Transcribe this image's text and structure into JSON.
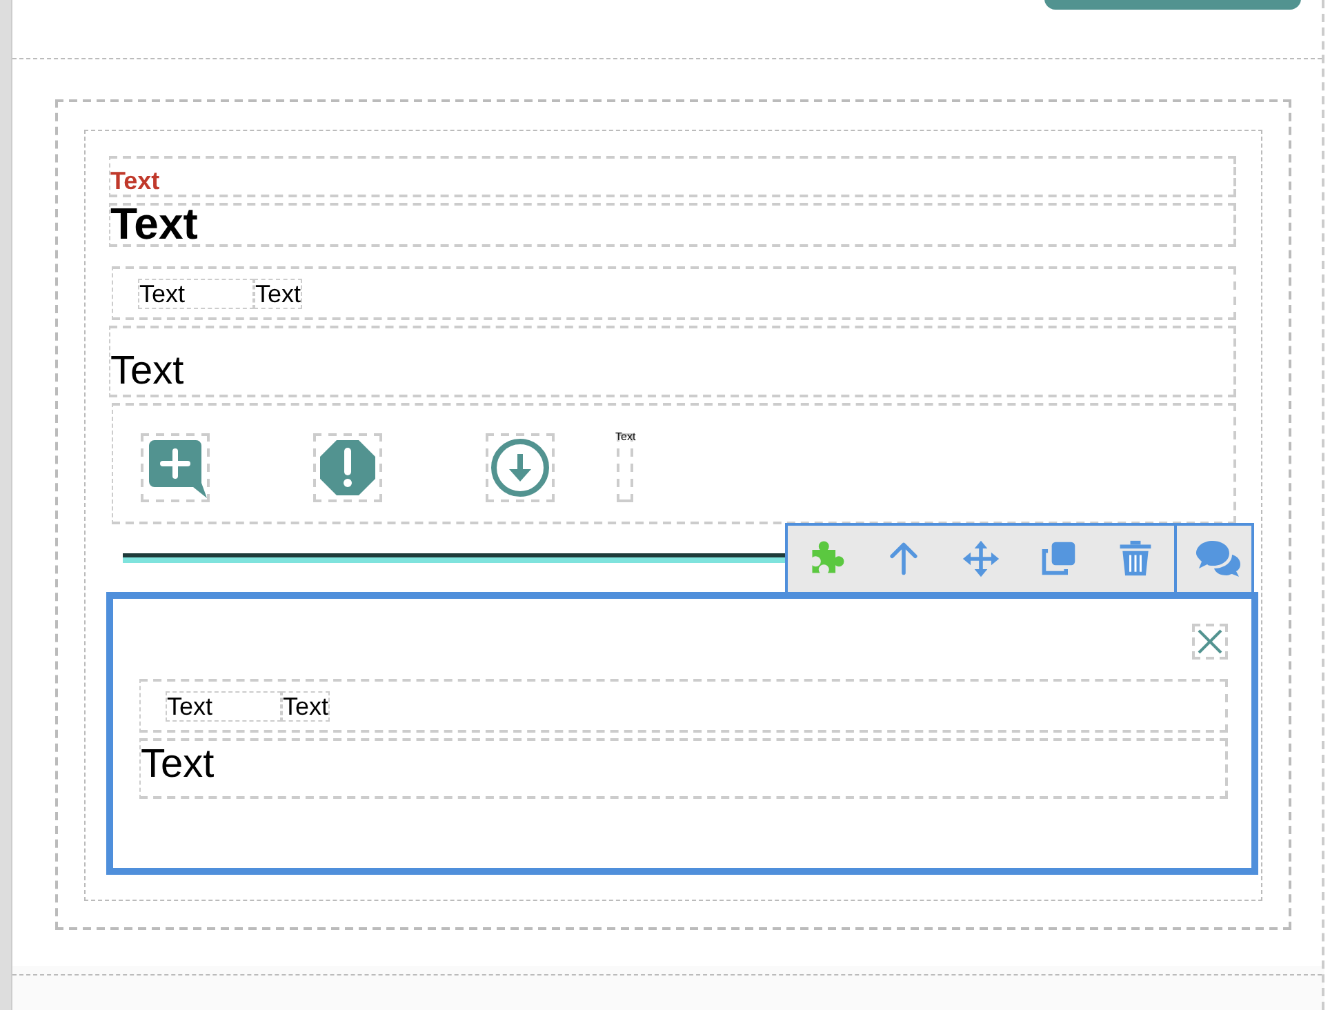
{
  "blocks": [
    {
      "kind": "label",
      "text": "Text"
    },
    {
      "kind": "heading",
      "text": "Text"
    },
    {
      "kind": "pair",
      "texts": [
        "Text",
        "Text"
      ]
    },
    {
      "kind": "paragraph",
      "text": "Text"
    },
    {
      "kind": "icons",
      "icons": [
        {
          "kind": "comment-plus"
        },
        {
          "kind": "alert"
        },
        {
          "kind": "download"
        }
      ],
      "caption": "Text"
    }
  ],
  "toolbar": {
    "tools": [
      {
        "kind": "puzzle"
      },
      {
        "kind": "up"
      },
      {
        "kind": "move"
      },
      {
        "kind": "copy"
      },
      {
        "kind": "delete"
      }
    ],
    "extra": {
      "kind": "comments"
    }
  },
  "selected_block": {
    "blocks": [
      {
        "kind": "pair",
        "texts": [
          "Text",
          "Text"
        ]
      },
      {
        "kind": "paragraph",
        "text": "Text"
      }
    ]
  }
}
